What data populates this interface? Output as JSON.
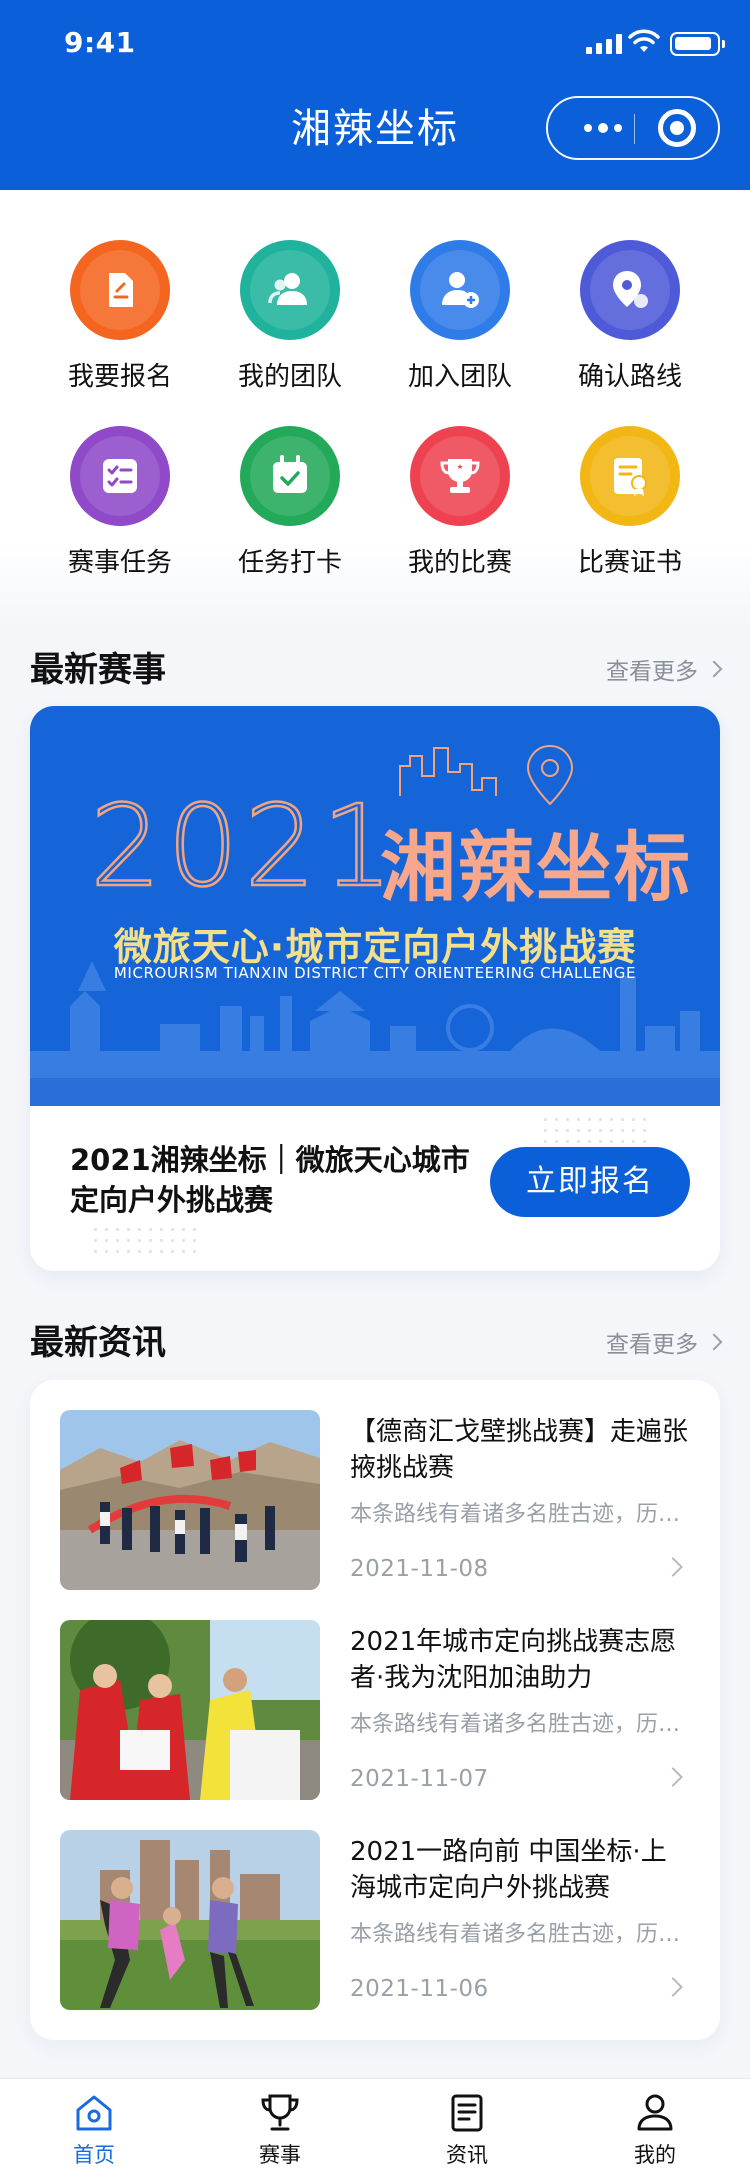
{
  "status_bar": {
    "time": "9:41"
  },
  "app": {
    "title": "湘辣坐标",
    "capsule": {
      "more_icon": "ellipsis-icon",
      "close_icon": "target-icon"
    }
  },
  "menu": [
    {
      "label": "我要报名",
      "icon": "document-edit-icon",
      "color": "#f4651f"
    },
    {
      "label": "我的团队",
      "icon": "users-icon",
      "color": "#1fb39e"
    },
    {
      "label": "加入团队",
      "icon": "user-add-icon",
      "color": "#2f7ce8"
    },
    {
      "label": "确认路线",
      "icon": "location-pin-icon",
      "color": "#4f5ad8"
    },
    {
      "label": "赛事任务",
      "icon": "task-list-icon",
      "color": "#8f49c9"
    },
    {
      "label": "任务打卡",
      "icon": "calendar-check-icon",
      "color": "#23a95a"
    },
    {
      "label": "我的比赛",
      "icon": "trophy-icon",
      "color": "#ee4251"
    },
    {
      "label": "比赛证书",
      "icon": "certificate-icon",
      "color": "#f2b714"
    }
  ],
  "events_section": {
    "title": "最新赛事",
    "more": "查看更多",
    "banner": {
      "year": "2021",
      "brand": "湘辣坐标",
      "subtitle": "微旅天心·城市定向户外挑战赛",
      "subtitle_en": "MICROURISM TIANXIN DISTRICT CITY ORIENTEERING CHALLENGE"
    },
    "event_title": "2021湘辣坐标｜微旅天心城市定向户外挑战赛",
    "signup_label": "立即报名"
  },
  "news_section": {
    "title": "最新资讯",
    "more": "查看更多",
    "items": [
      {
        "title": "【德商汇戈壁挑战赛】走遍张掖挑战赛",
        "desc": "本条路线有着诸多名胜古迹，历史文化悠久",
        "date": "2021-11-08"
      },
      {
        "title": "2021年城市定向挑战赛志愿者·我为沈阳加油助力",
        "desc": "本条路线有着诸多名胜古迹，历史文化悠久",
        "date": "2021-11-07"
      },
      {
        "title": "2021一路向前 中国坐标·上海城市定向户外挑战赛",
        "desc": "本条路线有着诸多名胜古迹，历史文化悠久",
        "date": "2021-11-06"
      }
    ]
  },
  "tabbar": [
    {
      "label": "首页",
      "icon": "home-icon",
      "active": true
    },
    {
      "label": "赛事",
      "icon": "trophy-icon",
      "active": false
    },
    {
      "label": "资讯",
      "icon": "news-icon",
      "active": false
    },
    {
      "label": "我的",
      "icon": "user-icon",
      "active": false
    }
  ],
  "colors": {
    "primary": "#0b5fd9",
    "active_tab": "#1a6ae0"
  }
}
